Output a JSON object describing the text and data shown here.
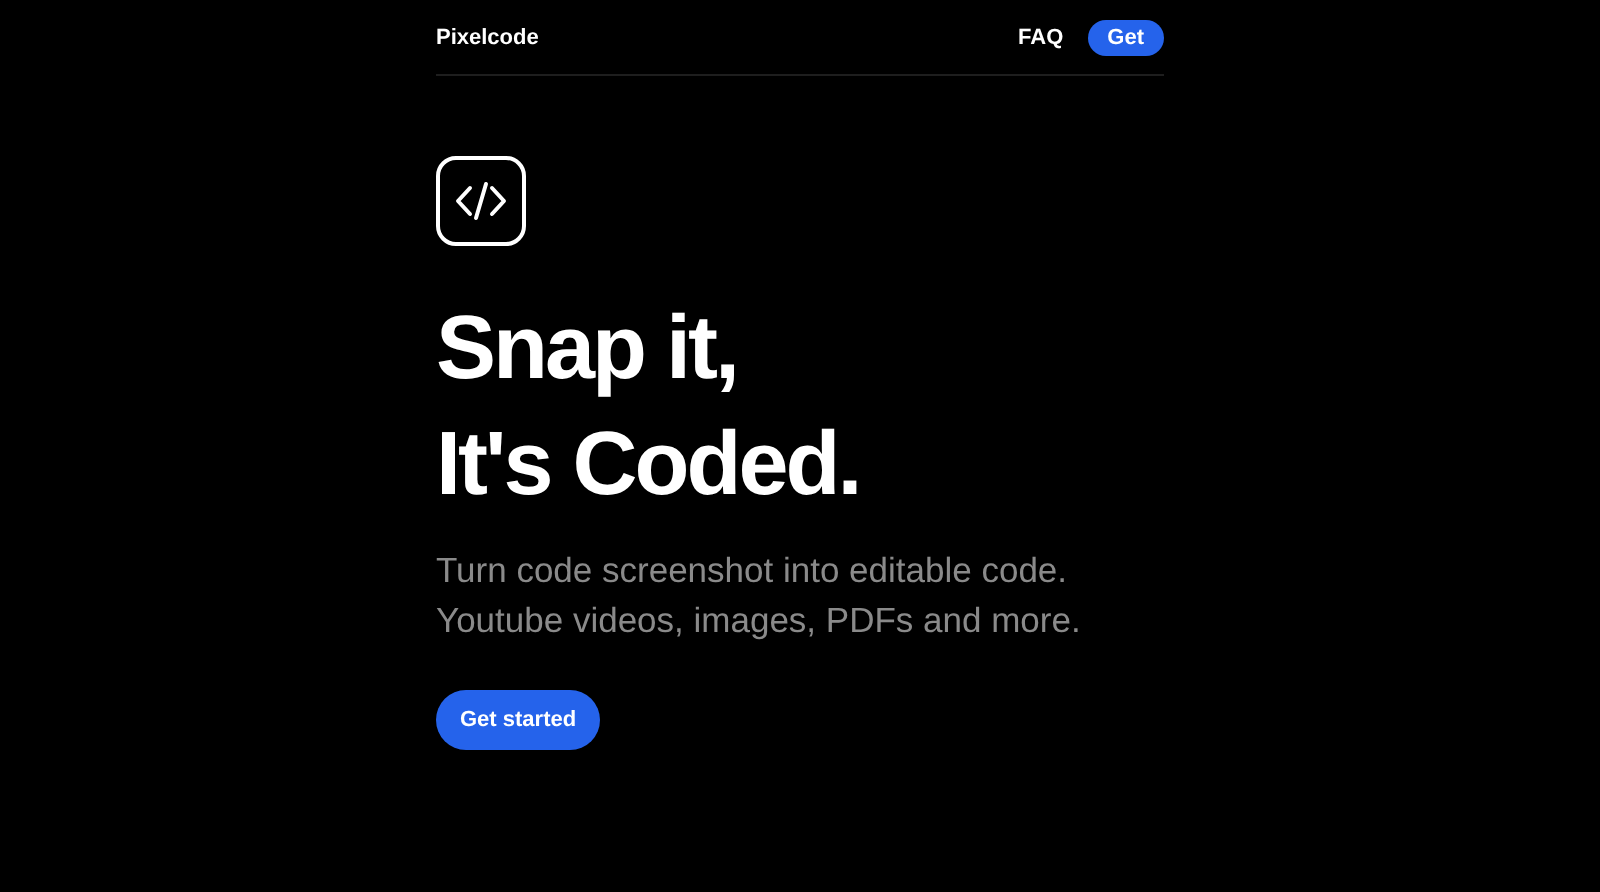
{
  "header": {
    "logo": "Pixelcode",
    "nav_link": "FAQ",
    "cta": "Get"
  },
  "hero": {
    "headline": [
      "Snap it,",
      "It's Coded."
    ],
    "subtitle": [
      "Turn code screenshot into editable code.",
      "Youtube videos, images, PDFs and more."
    ],
    "button": "Get started"
  }
}
